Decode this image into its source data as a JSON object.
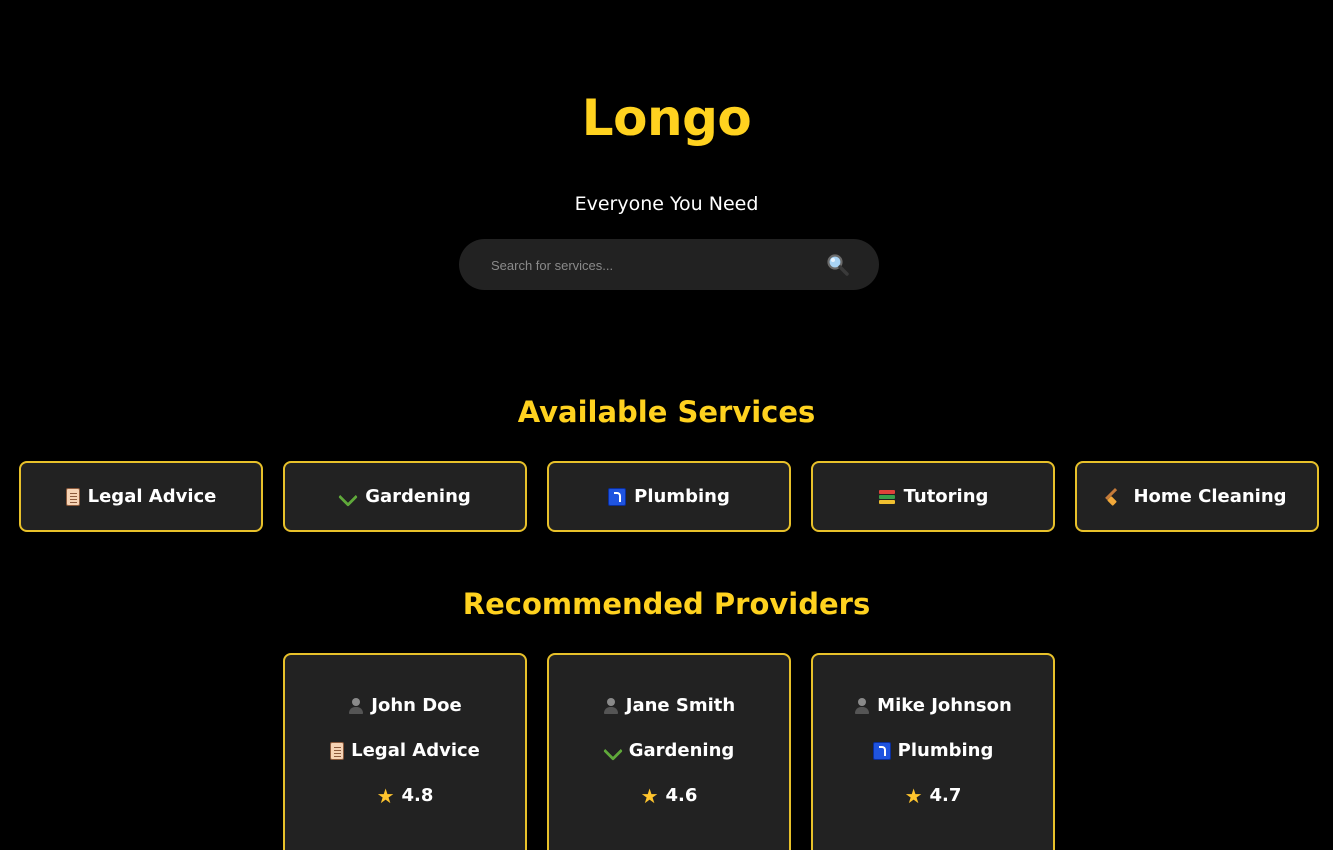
{
  "header": {
    "brand": "Longo",
    "tagline": "Everyone You Need"
  },
  "search": {
    "placeholder": "Search for services...",
    "button_icon": "magnifier-icon"
  },
  "services": {
    "title": "Available Services",
    "items": [
      {
        "label": "Legal Advice",
        "icon": "scroll-icon"
      },
      {
        "label": "Gardening",
        "icon": "herb-icon"
      },
      {
        "label": "Plumbing",
        "icon": "plumbing-icon"
      },
      {
        "label": "Tutoring",
        "icon": "books-icon"
      },
      {
        "label": "Home Cleaning",
        "icon": "broom-icon"
      }
    ]
  },
  "providers": {
    "title": "Recommended Providers",
    "items": [
      {
        "name": "John Doe",
        "service": "Legal Advice",
        "service_icon": "scroll-icon",
        "rating": "4.8"
      },
      {
        "name": "Jane Smith",
        "service": "Gardening",
        "service_icon": "herb-icon",
        "rating": "4.6"
      },
      {
        "name": "Mike Johnson",
        "service": "Plumbing",
        "service_icon": "plumbing-icon",
        "rating": "4.7"
      }
    ]
  },
  "colors": {
    "background": "#000000",
    "accent": "#FFD21F",
    "card": "#222222",
    "card_border": "#E8C12A"
  }
}
